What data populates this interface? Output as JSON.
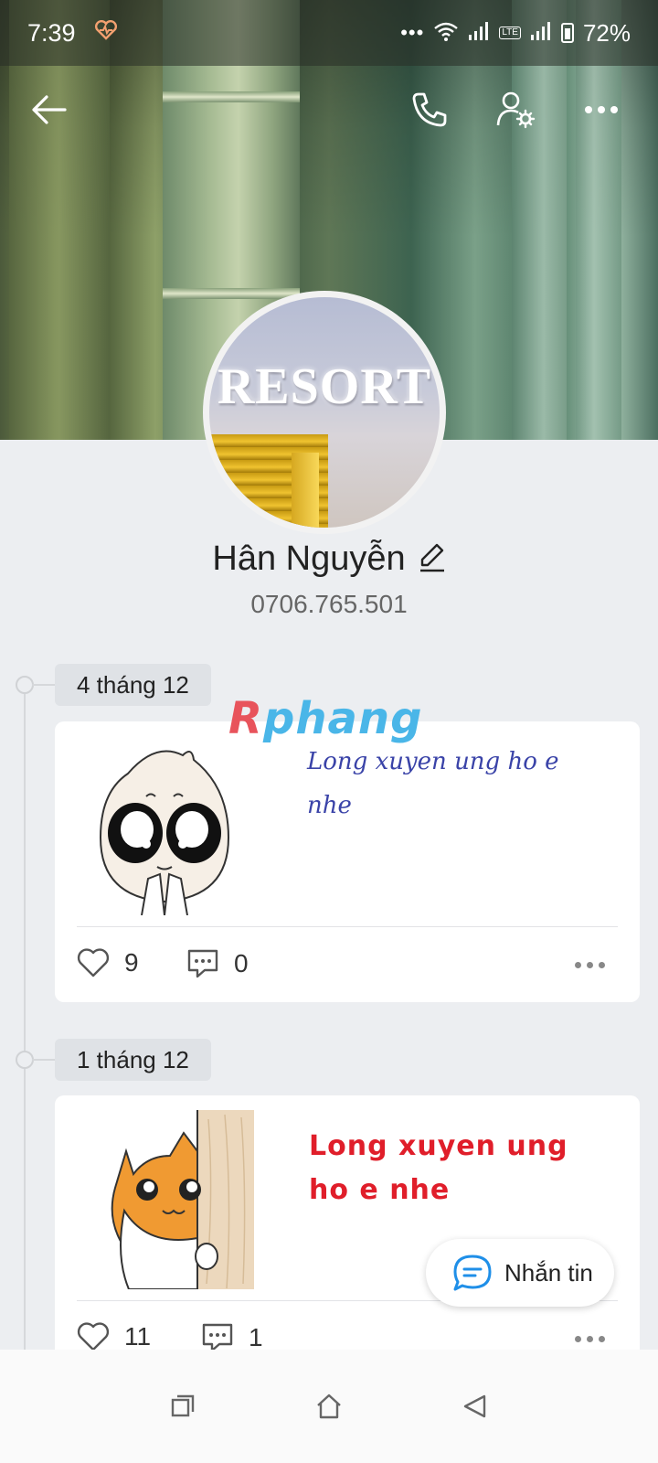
{
  "status_bar": {
    "time": "7:39",
    "dots": "•••",
    "battery_percent": "72%"
  },
  "profile": {
    "name": "Hân Nguyễn",
    "phone": "0706.765.501",
    "avatar_text": "RESORT"
  },
  "watermark": {
    "first": "R",
    "rest": "phang"
  },
  "posts": [
    {
      "date": "4 tháng 12",
      "text_line1": "Long xuyen ung ho e",
      "text_line2": "nhe",
      "likes": "9",
      "comments": "0"
    },
    {
      "date": "1 tháng 12",
      "text_line1": "Long xuyen ung",
      "text_line2": "ho e nhe",
      "likes": "11",
      "comments": "1"
    }
  ],
  "message_button": {
    "label": "Nhắn tin"
  },
  "colors": {
    "accent_blue": "#1f8fe8",
    "post2_text": "#e01e2a",
    "post1_text": "#3a43a8"
  },
  "icons": {
    "back": "arrow-left-icon",
    "call": "phone-icon",
    "settings": "user-settings-icon",
    "more": "more-horizontal-icon",
    "edit": "pencil-icon",
    "like": "heart-icon",
    "comment": "comment-icon",
    "message": "chat-bubble-icon",
    "recents": "recents-icon",
    "home": "home-icon",
    "nav_back": "triangle-back-icon"
  }
}
